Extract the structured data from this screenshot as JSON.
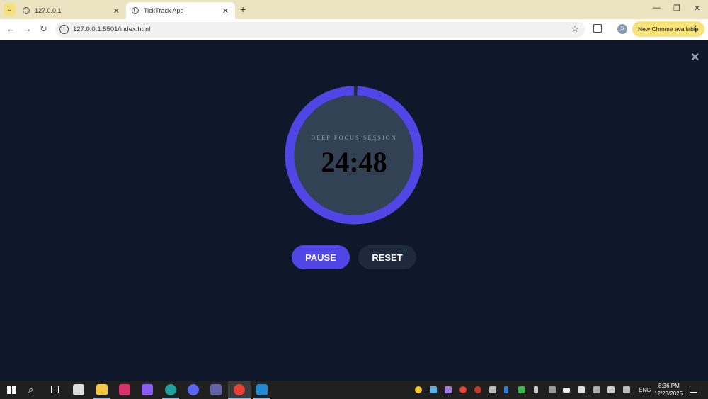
{
  "browser": {
    "tabs": [
      {
        "title": "127.0.0.1",
        "active": false
      },
      {
        "title": "TickTrack App",
        "active": true
      }
    ],
    "new_tab_label": "+",
    "address": "127.0.0.1:5501/index.html",
    "profile_initial": "S",
    "update_label": "New Chrome available"
  },
  "app": {
    "session_label": "DEEP FOCUS SESSION",
    "time": "24:48",
    "progress_remaining": 0.992,
    "pause_label": "PAUSE",
    "reset_label": "RESET",
    "colors": {
      "background": "#0f172a",
      "ring": "#4f46e5",
      "dial": "#334155",
      "reset": "#1e293b"
    }
  },
  "taskbar": {
    "language": "ENG",
    "time": "8:36 PM",
    "date": "12/23/2025"
  }
}
